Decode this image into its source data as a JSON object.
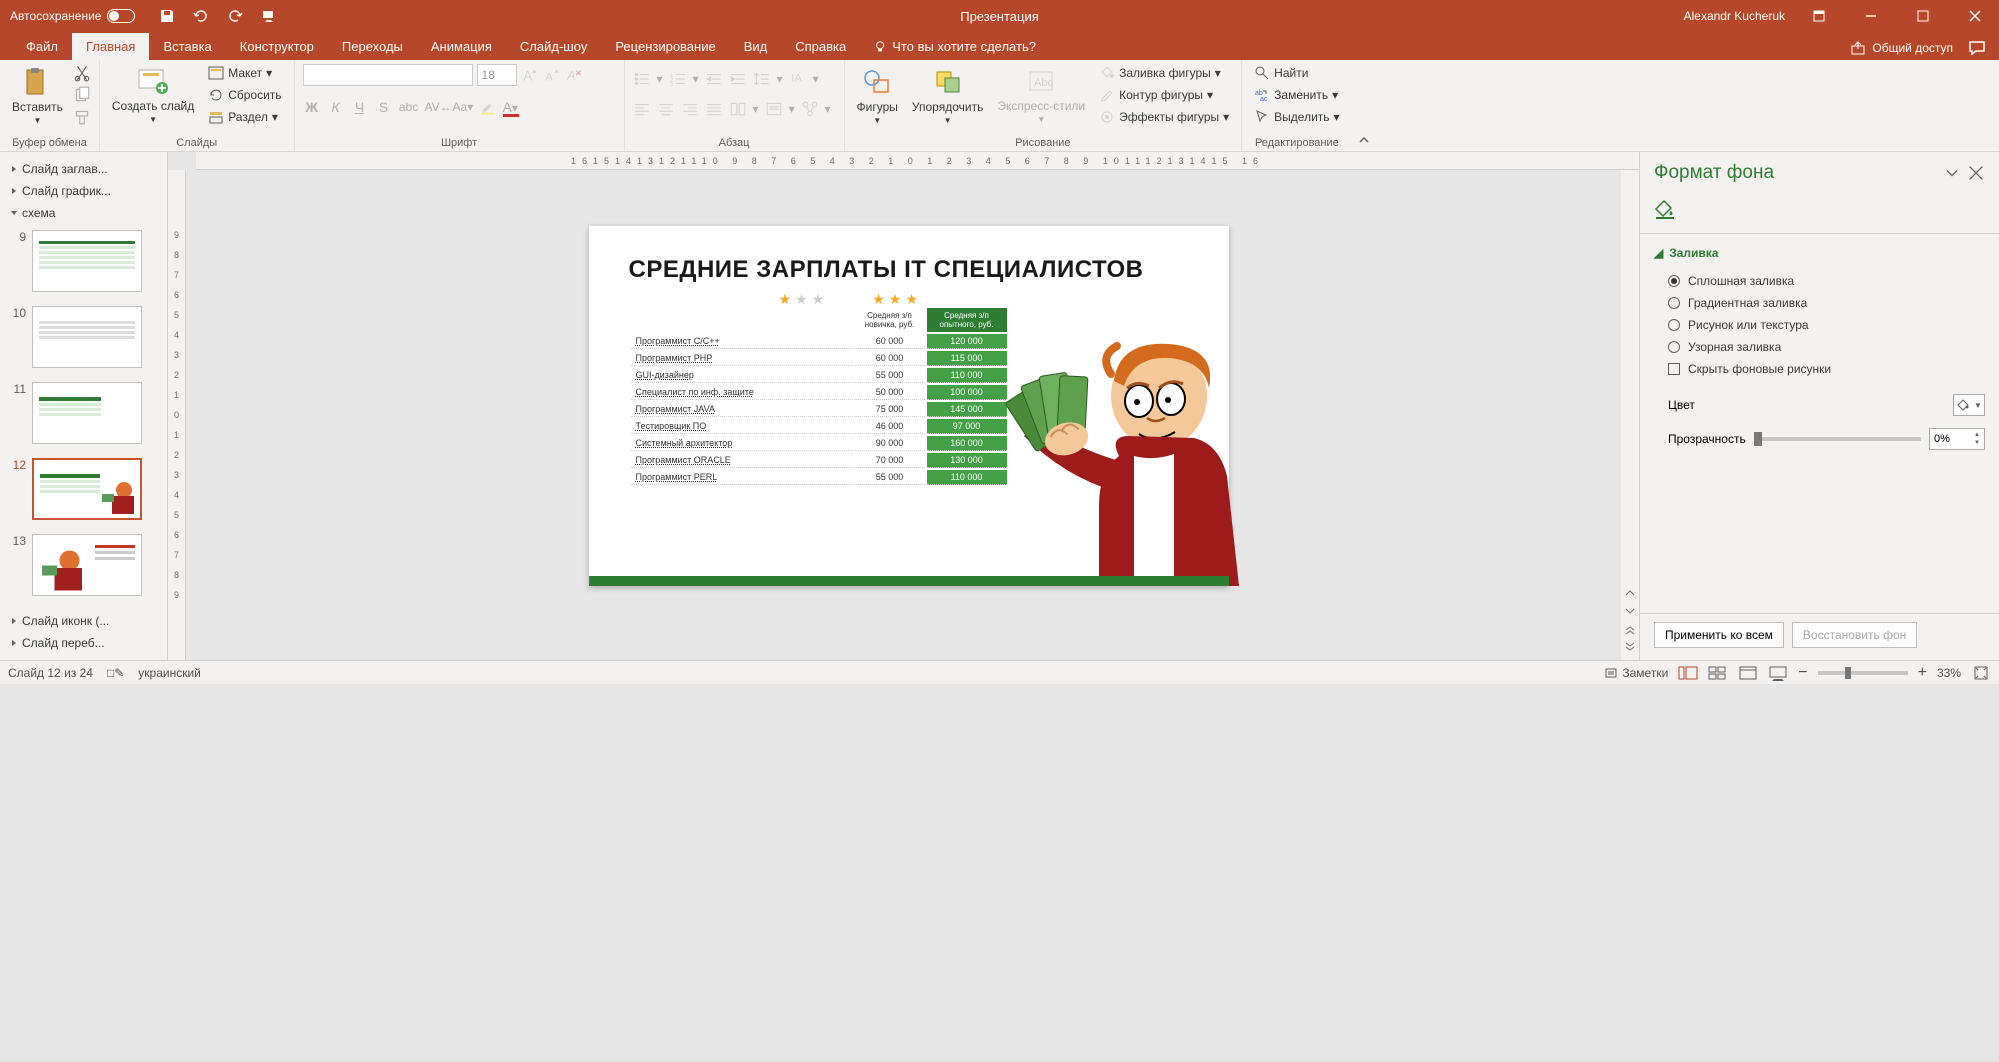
{
  "titlebar": {
    "autosave_label": "Автосохранение",
    "doc_title": "Презентация",
    "user_name": "Alexandr Kucheruk"
  },
  "tabs": {
    "file": "Файл",
    "home": "Главная",
    "insert": "Вставка",
    "design": "Конструктор",
    "transitions": "Переходы",
    "animations": "Анимация",
    "slideshow": "Слайд-шоу",
    "review": "Рецензирование",
    "view": "Вид",
    "help": "Справка",
    "tell_me": "Что вы хотите сделать?",
    "share": "Общий доступ"
  },
  "ribbon": {
    "clipboard": {
      "paste": "Вставить",
      "label": "Буфер обмена"
    },
    "slides": {
      "new_slide": "Создать слайд",
      "layout": "Макет",
      "reset": "Сбросить",
      "section": "Раздел",
      "label": "Слайды"
    },
    "font": {
      "size": "18",
      "label": "Шрифт"
    },
    "paragraph": {
      "label": "Абзац"
    },
    "drawing": {
      "shapes": "Фигуры",
      "arrange": "Упорядочить",
      "quick_styles": "Экспресс-стили",
      "shape_fill": "Заливка фигуры",
      "shape_outline": "Контур фигуры",
      "shape_effects": "Эффекты фигуры",
      "label": "Рисование"
    },
    "editing": {
      "find": "Найти",
      "replace": "Заменить",
      "select": "Выделить",
      "label": "Редактирование"
    }
  },
  "outline": {
    "section1": "Слайд заглав...",
    "section2": "Слайд график...",
    "section3": "схема",
    "section4": "Слайд иконк (...",
    "section5": "Слайд переб...",
    "thumbs": [
      "9",
      "10",
      "11",
      "12",
      "13"
    ]
  },
  "slide": {
    "title": "СРЕДНИЕ ЗАРПЛАТЫ IT СПЕЦИАЛИСТОВ",
    "col1": "Средняя з/п новичка, руб.",
    "col2": "Средняя з/п опытного, руб.",
    "rows": [
      {
        "name": "Программист C/C++",
        "v1": "60 000",
        "v2": "120 000"
      },
      {
        "name": "Программист PHP",
        "v1": "60 000",
        "v2": "115 000"
      },
      {
        "name": "GUI-дизайнер",
        "v1": "55 000",
        "v2": "110 000"
      },
      {
        "name": "Специалист по инф. защите",
        "v1": "50 000",
        "v2": "100 000"
      },
      {
        "name": "Программист JAVA",
        "v1": "75 000",
        "v2": "145 000"
      },
      {
        "name": "Тестировщик ПО",
        "v1": "46 000",
        "v2": "97 000"
      },
      {
        "name": "Системный архитектор",
        "v1": "90 000",
        "v2": "160 000"
      },
      {
        "name": "Программист ORACLE",
        "v1": "70 000",
        "v2": "130 000"
      },
      {
        "name": "Программист PERL",
        "v1": "55 000",
        "v2": "110 000"
      }
    ]
  },
  "format_pane": {
    "title": "Формат фона",
    "section_fill": "Заливка",
    "solid": "Сплошная заливка",
    "gradient": "Градиентная заливка",
    "picture": "Рисунок или текстура",
    "pattern": "Узорная заливка",
    "hide_bg": "Скрыть фоновые рисунки",
    "color_label": "Цвет",
    "transparency_label": "Прозрачность",
    "transparency_value": "0%",
    "apply_all": "Применить ко всем",
    "reset_bg": "Восстановить фон"
  },
  "statusbar": {
    "slide_info": "Слайд 12 из 24",
    "language": "украинский",
    "notes": "Заметки",
    "zoom": "33%"
  },
  "ruler_h": "16151413121110 9 8 7 6 5 4 3 2 1 0 1 2 3 4 5 6 7 8 9 101112131415 16",
  "ruler_v": [
    "9",
    "8",
    "7",
    "6",
    "5",
    "4",
    "3",
    "2",
    "1",
    "0",
    "1",
    "2",
    "3",
    "4",
    "5",
    "6",
    "7",
    "8",
    "9"
  ]
}
